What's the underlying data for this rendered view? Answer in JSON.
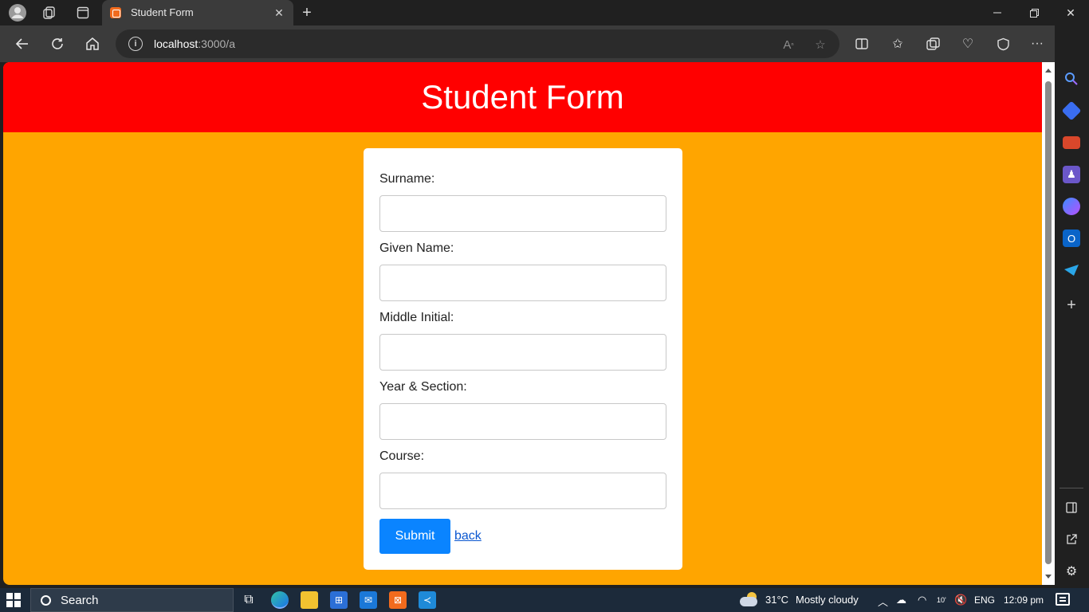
{
  "browser": {
    "tab_title": "Student Form",
    "url_host": "localhost",
    "url_path": ":3000/a"
  },
  "page": {
    "header_title": "Student Form",
    "fields": [
      {
        "label": "Surname:",
        "value": ""
      },
      {
        "label": "Given Name:",
        "value": ""
      },
      {
        "label": "Middle Initial:",
        "value": ""
      },
      {
        "label": "Year & Section:",
        "value": ""
      },
      {
        "label": "Course:",
        "value": ""
      }
    ],
    "submit_label": "Submit",
    "back_label": "back",
    "colors": {
      "header": "#ff0000",
      "background": "#ffa500",
      "submit": "#0a84ff"
    }
  },
  "taskbar": {
    "search_label": "Search",
    "temperature": "31°C",
    "weather": "Mostly cloudy",
    "language": "ENG",
    "time": "12:09 pm"
  }
}
